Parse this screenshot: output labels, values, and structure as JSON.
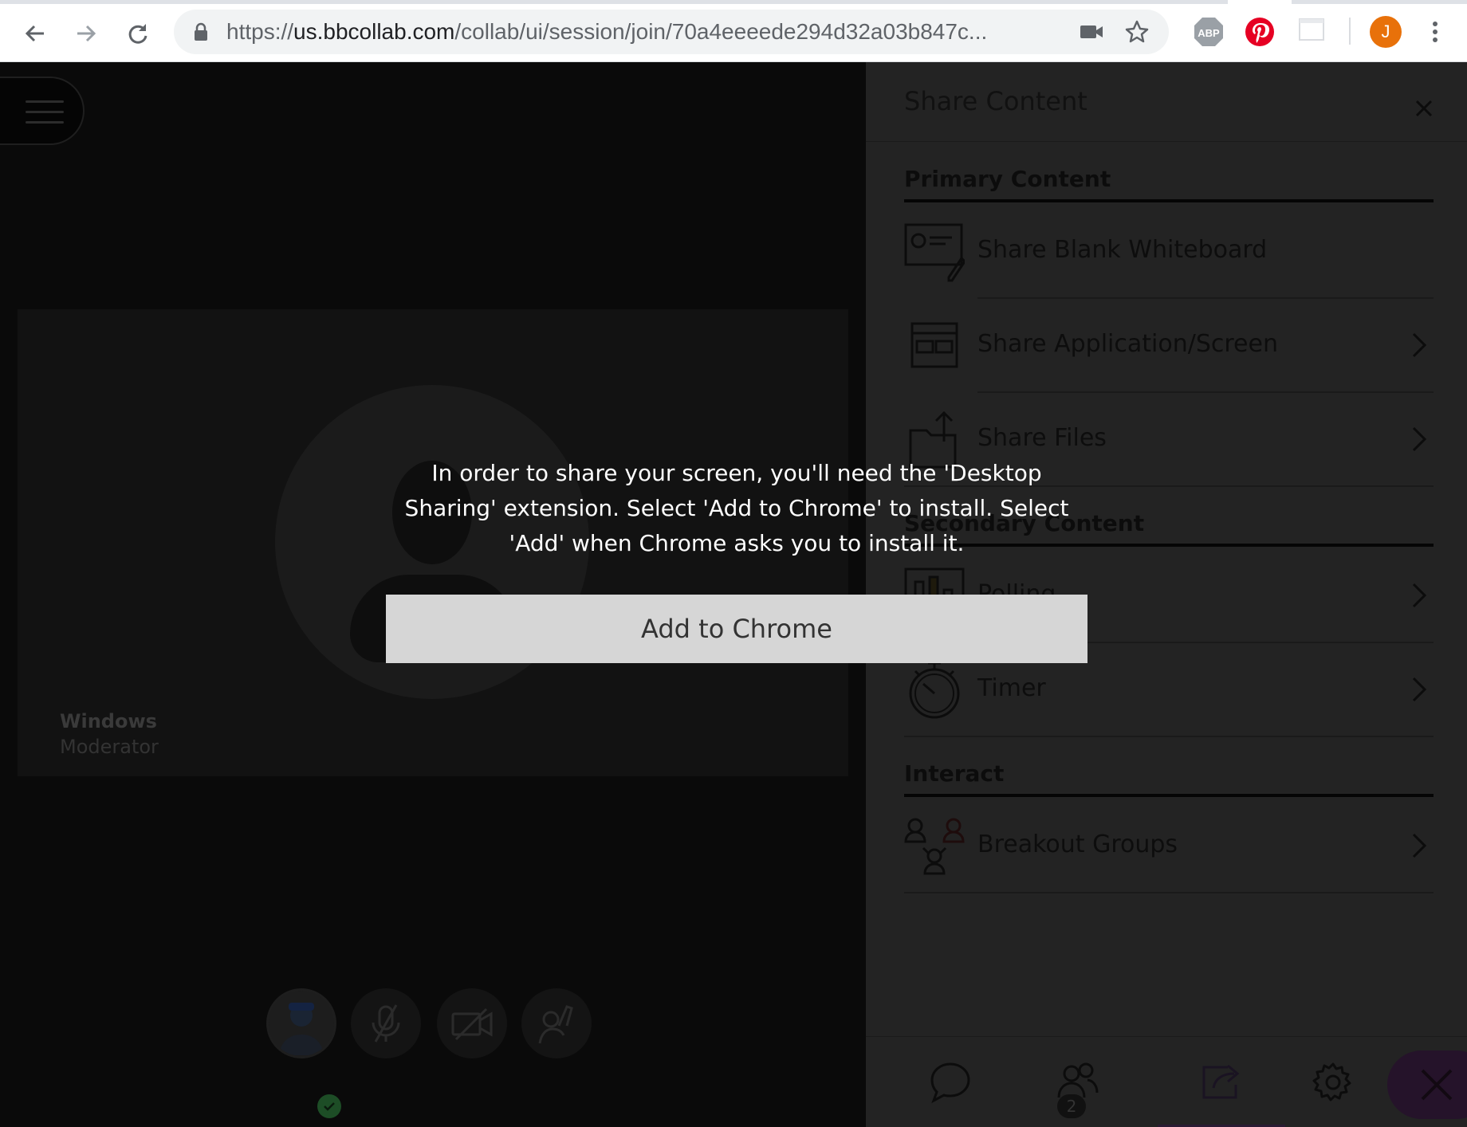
{
  "browser": {
    "url_scheme": "https://",
    "url_host": "us.bbcollab.com",
    "url_path": "/collab/ui/session/join/70a4eeeede294d32a03b847c...",
    "profile_initial": "J",
    "extensions": [
      "abp-icon",
      "pinterest-icon",
      "blank-extension-icon"
    ],
    "profile_color": "#e8710a"
  },
  "stage": {
    "participant_name": "Windows",
    "participant_role": "Moderator"
  },
  "panel": {
    "title": "Share Content",
    "sections": [
      {
        "title": "Primary Content",
        "items": [
          {
            "label": "Share Blank Whiteboard",
            "icon": "whiteboard-icon",
            "has_chevron": false
          },
          {
            "label": "Share Application/Screen",
            "icon": "application-screen-icon",
            "has_chevron": true
          },
          {
            "label": "Share Files",
            "icon": "share-files-icon",
            "has_chevron": true
          }
        ]
      },
      {
        "title": "Secondary Content",
        "items": [
          {
            "label": "Polling",
            "icon": "polling-icon",
            "has_chevron": true
          },
          {
            "label": "Timer",
            "icon": "timer-icon",
            "has_chevron": true
          }
        ]
      },
      {
        "title": "Interact",
        "items": [
          {
            "label": "Breakout Groups",
            "icon": "breakout-groups-icon",
            "has_chevron": true
          }
        ]
      }
    ],
    "footer": {
      "attendee_count": "2"
    }
  },
  "modal": {
    "message": "In order to share your screen, you'll need the 'Desktop Sharing' extension. Select 'Add to Chrome' to install. Select 'Add' when Chrome asks you to install it.",
    "button_label": "Add to Chrome"
  },
  "colors": {
    "panel_bg": "#232323",
    "stage_bg": "#0a0a0a",
    "modal_button_bg": "#d6d6d6",
    "accent_purple": "#2a1b33"
  }
}
